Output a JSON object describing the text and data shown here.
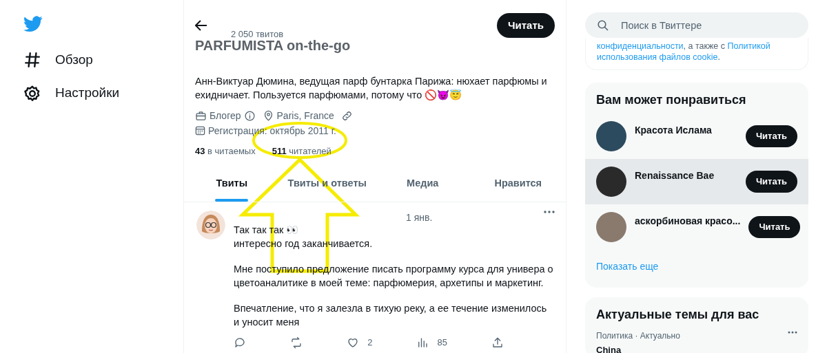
{
  "nav": {
    "items": [
      {
        "label": "Обзор",
        "kind": "explore"
      },
      {
        "label": "Настройки",
        "kind": "settings"
      }
    ]
  },
  "profile_header": {
    "tweet_count": "2 050 твитов",
    "follow_button": "Читать"
  },
  "profile": {
    "name": "PARFUMISTA on-the-go",
    "bio": "Анн-Виктуар Дюмина, ведущая парф бунтарка Парижа: нюхает парфюмы и ехидничает. Пользуется парфюмами, потому что 🚫😈😇",
    "meta": [
      {
        "kind": "job",
        "text": "Блогер"
      },
      {
        "kind": "location",
        "text": "Paris, France"
      },
      {
        "kind": "link"
      }
    ],
    "joined": "Регистрация: октябрь 2011 г.",
    "following": {
      "count": "43",
      "label": "в читаемых"
    },
    "followers": {
      "count": "511",
      "label": "читателей"
    }
  },
  "tabs": [
    {
      "label": "Твиты",
      "selected": true
    },
    {
      "label": "Твиты и ответы",
      "selected": false
    },
    {
      "label": "Медиа",
      "selected": false
    },
    {
      "label": "Нравится",
      "selected": false
    }
  ],
  "tweet": {
    "date": "1 янв.",
    "paragraphs": [
      "Так так так 👀\nинтересно год заканчивается.",
      "Мне поступило предложение писать программу курса для универа о цветоаналитике в моей теме: парфюмерия, архетипы и маркетинг.",
      "Впечатление, что я залезла в тихую реку, а ее течение изменилось и уносит меня"
    ],
    "actions": [
      {
        "kind": "reply"
      },
      {
        "kind": "retweet"
      },
      {
        "kind": "like",
        "count": "2"
      },
      {
        "kind": "views",
        "count": "85"
      },
      {
        "kind": "share"
      }
    ]
  },
  "search": {
    "placeholder": "Поиск в Твиттере"
  },
  "notice": {
    "lines": [
      [
        {
          "kind": "link",
          "text": "конфиденциальности"
        },
        {
          "kind": "text",
          "text": ", а также с "
        },
        {
          "kind": "link",
          "text": "Политикой"
        }
      ],
      [
        {
          "kind": "link",
          "text": "использования файлов cookie"
        },
        {
          "kind": "text",
          "text": "."
        }
      ]
    ]
  },
  "suggestions": {
    "title": "Вам может понравиться",
    "items": [
      {
        "name": "Красота Ислама",
        "button": "Читать",
        "highlighted": false
      },
      {
        "name": "Renaissance Bae",
        "button": "Читать",
        "highlighted": true
      },
      {
        "name": "аскорбиновая красо...",
        "button": "Читать",
        "highlighted": false
      }
    ],
    "show_more": "Показать еще"
  },
  "trends": {
    "title": "Актуальные темы для вас",
    "items": [
      {
        "context": "Политика · Актуально",
        "topic": "China"
      }
    ]
  }
}
